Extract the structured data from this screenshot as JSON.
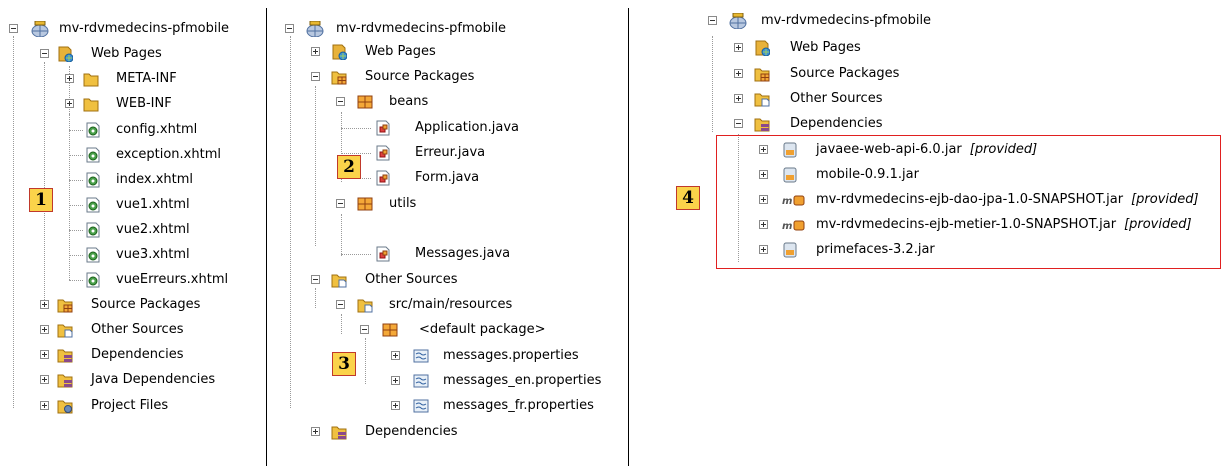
{
  "panel1": {
    "rows": [
      {
        "label": "mv-rdvmedecins-pfmobile",
        "icon": "project-globe-icon"
      },
      {
        "label": "Web Pages",
        "icon": "web-pages-folder-icon"
      },
      {
        "label": "META-INF",
        "icon": "folder-icon"
      },
      {
        "label": "WEB-INF",
        "icon": "folder-icon"
      },
      {
        "label": "config.xhtml",
        "icon": "xhtml-file-icon"
      },
      {
        "label": "exception.xhtml",
        "icon": "xhtml-file-icon"
      },
      {
        "label": "index.xhtml",
        "icon": "xhtml-file-icon"
      },
      {
        "label": "vue1.xhtml",
        "icon": "xhtml-file-icon"
      },
      {
        "label": "vue2.xhtml",
        "icon": "xhtml-file-icon"
      },
      {
        "label": "vue3.xhtml",
        "icon": "xhtml-file-icon"
      },
      {
        "label": "vueErreurs.xhtml",
        "icon": "xhtml-file-icon"
      },
      {
        "label": "Source Packages",
        "icon": "source-packages-icon"
      },
      {
        "label": "Other Sources",
        "icon": "other-sources-icon"
      },
      {
        "label": "Dependencies",
        "icon": "dependencies-icon"
      },
      {
        "label": "Java Dependencies",
        "icon": "dependencies-icon"
      },
      {
        "label": "Project Files",
        "icon": "project-files-icon"
      }
    ],
    "badge": "1"
  },
  "panel2": {
    "rows": [
      {
        "label": "mv-rdvmedecins-pfmobile",
        "icon": "project-globe-icon"
      },
      {
        "label": "Web Pages",
        "icon": "web-pages-folder-icon"
      },
      {
        "label": "Source Packages",
        "icon": "source-packages-icon"
      },
      {
        "label": "beans",
        "icon": "package-icon"
      },
      {
        "label": "Application.java",
        "icon": "java-file-icon"
      },
      {
        "label": "Erreur.java",
        "icon": "java-file-icon"
      },
      {
        "label": "Form.java",
        "icon": "java-file-icon"
      },
      {
        "label": "utils",
        "icon": "package-icon"
      },
      {
        "label": "Messages.java",
        "icon": "java-file-icon"
      },
      {
        "label": "Other Sources",
        "icon": "other-sources-icon"
      },
      {
        "label": "src/main/resources",
        "icon": "other-sources-icon"
      },
      {
        "label": "<default package>",
        "icon": "package-icon"
      },
      {
        "label": "messages.properties",
        "icon": "properties-file-icon"
      },
      {
        "label": "messages_en.properties",
        "icon": "properties-file-icon"
      },
      {
        "label": "messages_fr.properties",
        "icon": "properties-file-icon"
      },
      {
        "label": "Dependencies",
        "icon": "dependencies-icon"
      }
    ],
    "badge2": "2",
    "badge3": "3"
  },
  "panel3": {
    "rows": [
      {
        "label": "mv-rdvmedecins-pfmobile",
        "icon": "project-globe-icon"
      },
      {
        "label": "Web Pages",
        "icon": "web-pages-folder-icon"
      },
      {
        "label": "Source Packages",
        "icon": "source-packages-icon"
      },
      {
        "label": "Other Sources",
        "icon": "other-sources-icon"
      },
      {
        "label": "Dependencies",
        "icon": "dependencies-icon"
      },
      {
        "label": "javaee-web-api-6.0.jar",
        "icon": "jar-icon",
        "note": "[provided]"
      },
      {
        "label": "mobile-0.9.1.jar",
        "icon": "jar-icon"
      },
      {
        "label": "mv-rdvmedecins-ejb-dao-jpa-1.0-SNAPSHOT.jar",
        "icon": "maven-jar-icon",
        "note": "[provided]"
      },
      {
        "label": "mv-rdvmedecins-ejb-metier-1.0-SNAPSHOT.jar",
        "icon": "maven-jar-icon",
        "note": "[provided]"
      },
      {
        "label": "primefaces-3.2.jar",
        "icon": "jar-icon"
      }
    ],
    "badge": "4"
  },
  "colors": {
    "badge_fill": "#fbd34a",
    "badge_border": "#c0392b",
    "highlight_box": "#e02020"
  }
}
